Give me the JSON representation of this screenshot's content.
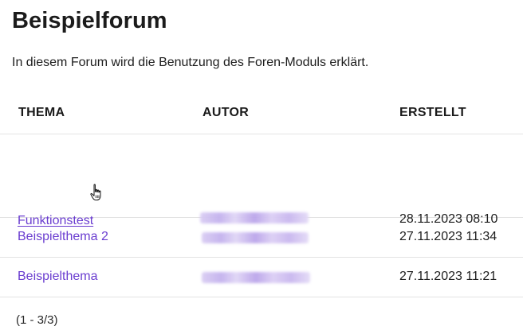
{
  "page": {
    "title": "Beispielforum",
    "description": "In diesem Forum wird die Benutzung des Foren-Moduls erklärt."
  },
  "table": {
    "headers": {
      "thema": "THEMA",
      "autor": "AUTOR",
      "erstellt": "ERSTELLT"
    },
    "rows": [
      {
        "thema": "Funktionstest",
        "autor": "",
        "erstellt": "28.11.2023 08:10",
        "hovered": true
      },
      {
        "thema": "Beispielthema 2",
        "autor": "",
        "erstellt": "27.11.2023 11:34",
        "hovered": false
      },
      {
        "thema": "Beispielthema",
        "autor": "",
        "erstellt": "27.11.2023 11:21",
        "hovered": false
      }
    ]
  },
  "pagination": {
    "text": "(1 - 3/3)"
  },
  "colors": {
    "link": "#6a3dd0",
    "divider": "#e3e3e3",
    "author_blur": "#c4b2ee"
  },
  "icons": {
    "cursor": "hand-pointer-icon"
  }
}
